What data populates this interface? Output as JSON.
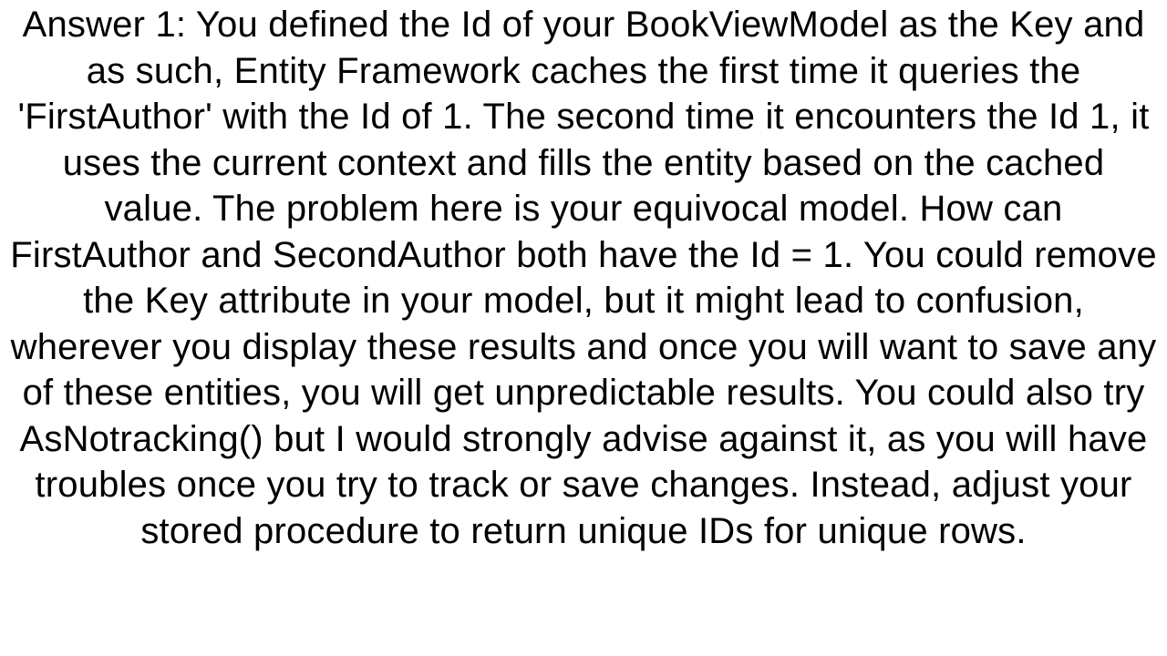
{
  "answer": {
    "text": "Answer 1: You defined the Id of your BookViewModel as the Key and as such, Entity Framework caches the first time it queries the 'FirstAuthor' with the Id of 1. The second time it encounters the Id 1, it uses the current context and fills the entity based on the cached value. The problem here is your equivocal model. How can FirstAuthor and SecondAuthor both have the Id = 1. You could remove the Key attribute in your model, but it might lead to confusion, wherever you display these results and once you will want to save any of these entities, you will get unpredictable results. You could also try AsNotracking() but I would strongly advise against it, as you will have troubles once you try to track or save changes. Instead, adjust your stored procedure to return unique IDs for unique rows."
  }
}
